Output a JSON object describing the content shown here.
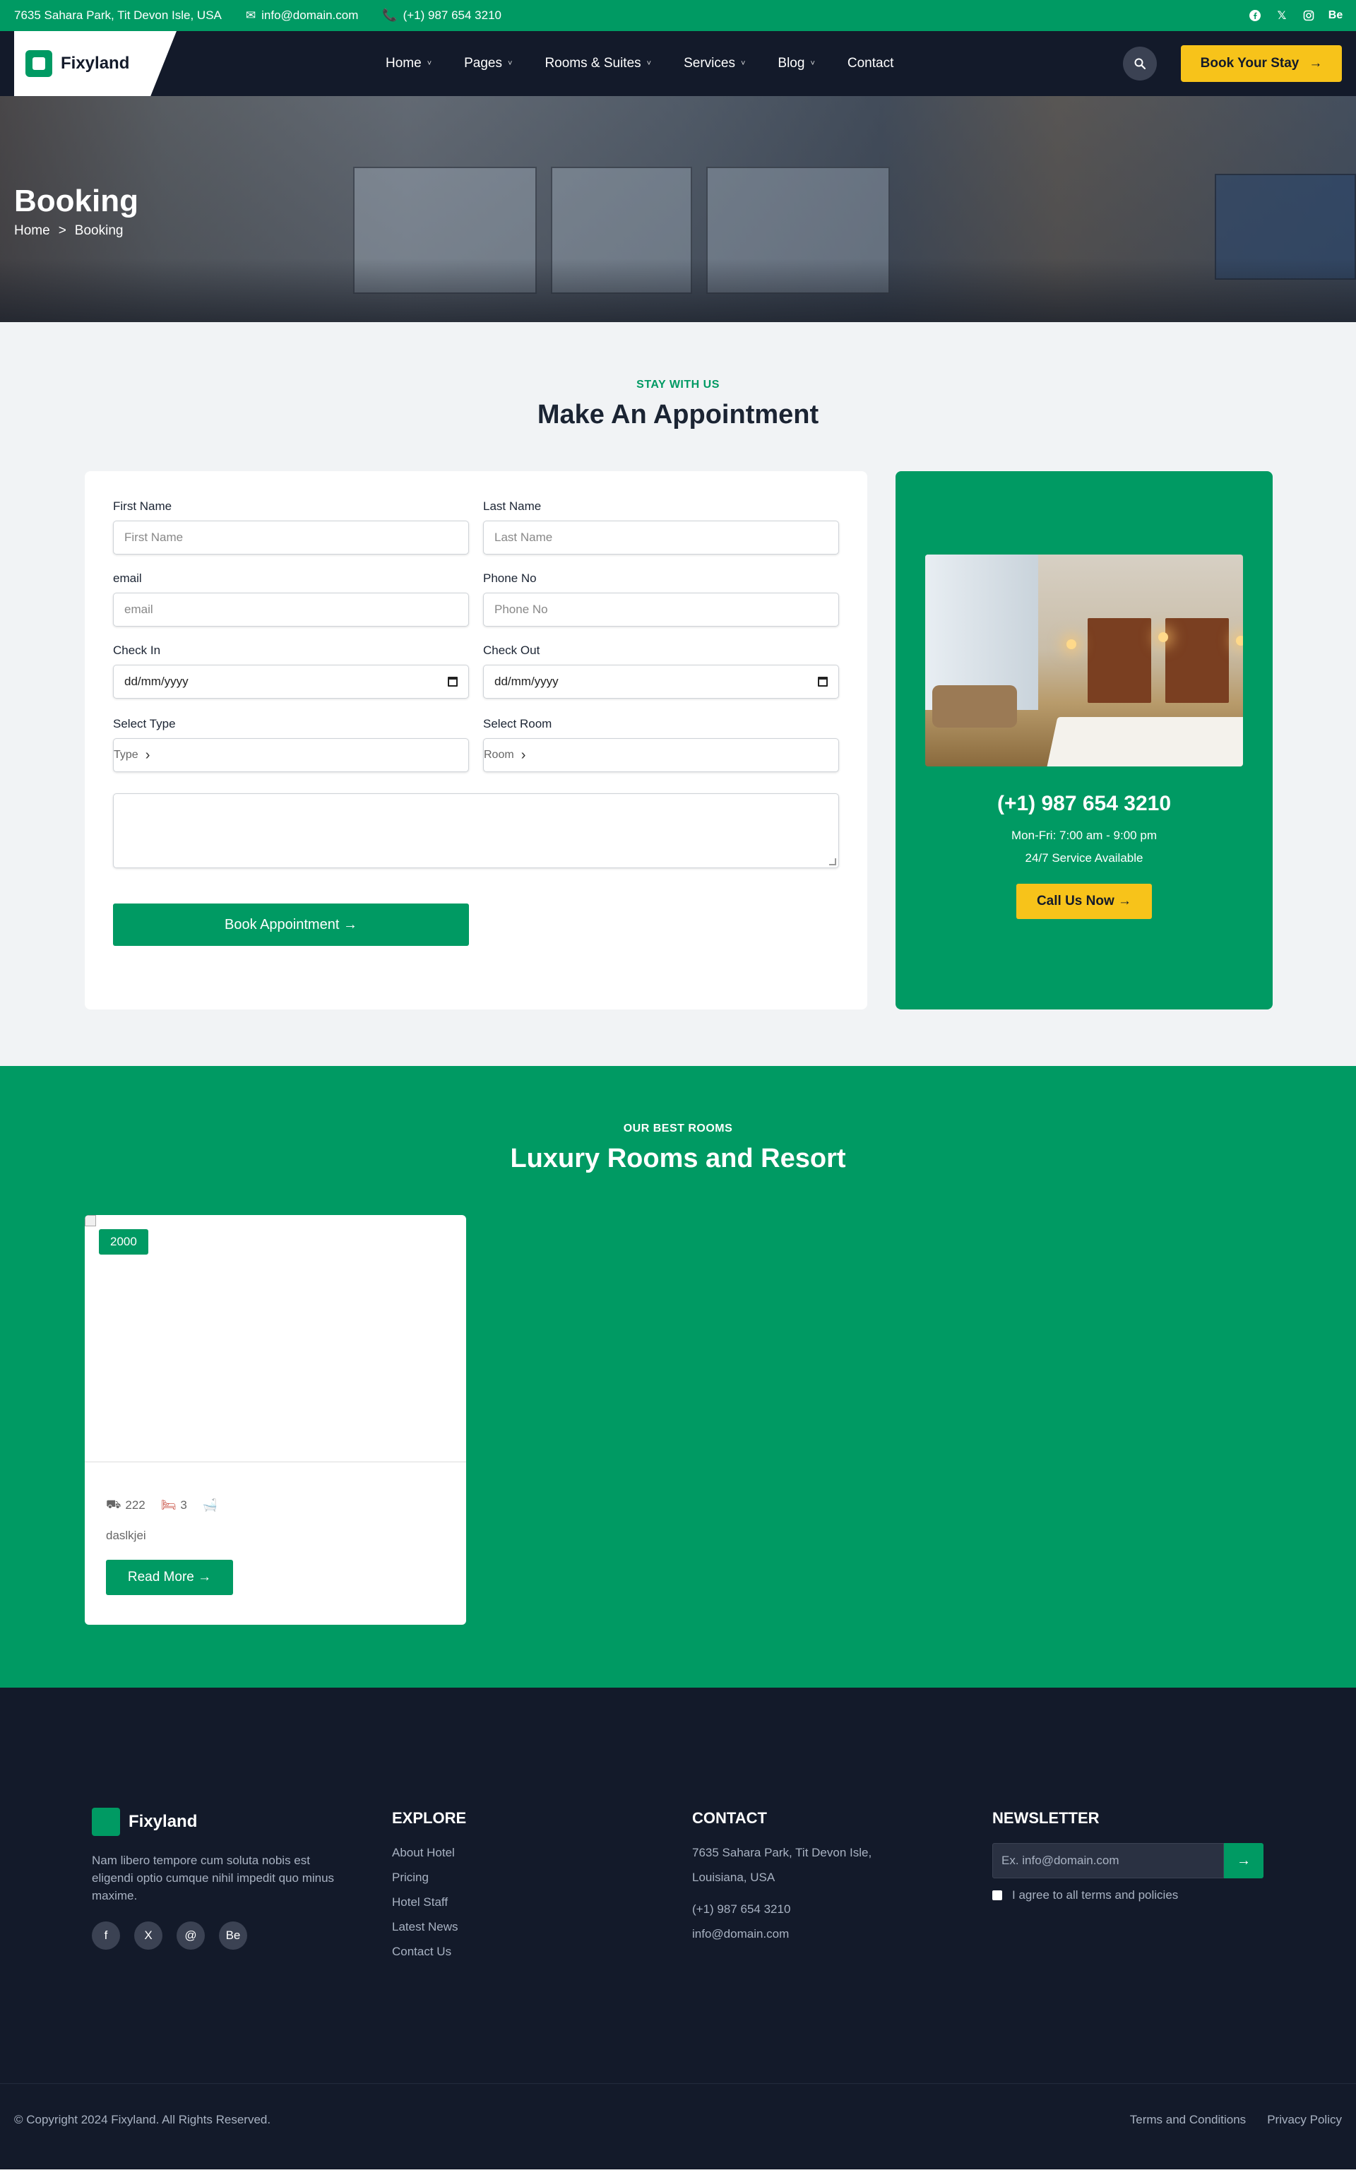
{
  "topbar": {
    "address": "7635 Sahara Park, Tit Devon Isle, USA",
    "email": "info@domain.com",
    "phone": "(+1) 987 654 3210",
    "social": [
      "facebook-icon",
      "x-icon",
      "instagram-icon",
      "behance-icon"
    ],
    "behance_label": "Be"
  },
  "nav": {
    "brand": "Fixyland",
    "items": [
      {
        "label": "Home",
        "has_dropdown": true
      },
      {
        "label": "Pages",
        "has_dropdown": true
      },
      {
        "label": "Rooms & Suites",
        "has_dropdown": true
      },
      {
        "label": "Services",
        "has_dropdown": true
      },
      {
        "label": "Blog",
        "has_dropdown": true
      },
      {
        "label": "Contact",
        "has_dropdown": false
      }
    ],
    "cta": "Book Your Stay",
    "cta_arrow": "→"
  },
  "hero": {
    "title": "Booking",
    "breadcrumb": {
      "home": "Home",
      "sep": ">",
      "current": "Booking"
    }
  },
  "appointment": {
    "eyebrow": "STAY WITH US",
    "title": "Make An Appointment",
    "fields": {
      "first_name": {
        "label": "First Name",
        "placeholder": "First Name"
      },
      "last_name": {
        "label": "Last Name",
        "placeholder": "Last Name"
      },
      "email": {
        "label": "email",
        "placeholder": "email"
      },
      "phone": {
        "label": "Phone No",
        "placeholder": "Phone No"
      },
      "check_in": {
        "label": "Check In",
        "value": "dd/mm/yyyy"
      },
      "check_out": {
        "label": "Check Out",
        "value": "dd/mm/yyyy"
      },
      "select_type": {
        "label": "Select Type",
        "value": "Type"
      },
      "select_room": {
        "label": "Select Room",
        "value": "Room"
      }
    },
    "submit": "Book Appointment →"
  },
  "contact_card": {
    "phone": "(+1) 987 654 3210",
    "hours": "Mon-Fri: 7:00 am - 9:00 pm",
    "service": "24/7 Service Available",
    "cta": "Call Us Now →"
  },
  "rooms": {
    "eyebrow": "OUR BEST ROOMS",
    "title": "Luxury Rooms and Resort",
    "cards": [
      {
        "price": "2000",
        "area": "222",
        "beds": "3",
        "description": "daslkjei",
        "cta": "Read More →"
      }
    ]
  },
  "footer": {
    "brand": "Fixyland",
    "about": "Nam libero tempore cum soluta nobis est eligendi optio cumque nihil impedit quo minus maxime.",
    "social": [
      "f",
      "X",
      "@",
      "Be"
    ],
    "explore": {
      "title": "EXPLORE",
      "links": [
        "About Hotel",
        "Pricing",
        "Hotel Staff",
        "Latest News",
        "Contact Us"
      ]
    },
    "contact": {
      "title": "CONTACT",
      "address_line1": "7635 Sahara Park, Tit Devon Isle,",
      "address_line2": "Louisiana, USA",
      "phone": "(+1) 987 654 3210",
      "email": "info@domain.com"
    },
    "newsletter": {
      "title": "NEWSLETTER",
      "placeholder": "Ex. info@domain.com",
      "submit_arrow": "→",
      "agree": "I agree to all terms and policies"
    },
    "copyright": "© Copyright 2024 Fixyland. All Rights Reserved.",
    "bottom_links": [
      "Terms and Conditions",
      "Privacy Policy"
    ]
  },
  "colors": {
    "brand_green": "#009a63",
    "navy": "#131a2a",
    "accent_yellow": "#f7c31a"
  }
}
